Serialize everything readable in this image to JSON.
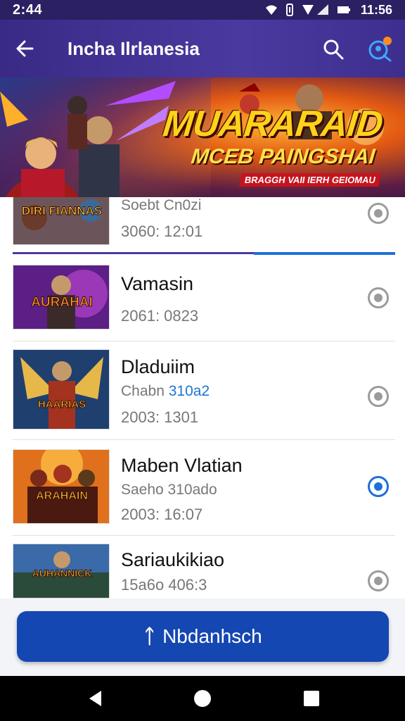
{
  "status_bar": {
    "time": "2:44",
    "clock": "11:56",
    "icons": [
      "wifi-icon",
      "vibrate-icon",
      "signal-icon",
      "battery-icon"
    ]
  },
  "app_bar": {
    "title": "Incha Ilrlanesia",
    "back_icon": "arrow-left-icon",
    "search_icon": "search-icon",
    "profile_icon": "profile-search-icon",
    "notification_color": "#ff8a1e"
  },
  "banner": {
    "title": "MUARARAID",
    "subtitle": "MCEB PAINGSHAI",
    "tagline": "BRAGGH VAII IERH GEIOMAU"
  },
  "list": {
    "progress_fraction": 0.37,
    "items": [
      {
        "thumb_text": "DIRI FIANNAS",
        "title": "",
        "subtitle": "Soebt Cn0zi",
        "subtitle_accent": "",
        "date": "3060: 12:01",
        "selected": false
      },
      {
        "thumb_text": "AURAHAI",
        "title": "Vamasin",
        "subtitle": "",
        "subtitle_accent": "",
        "date": "2061: 0823",
        "selected": false
      },
      {
        "thumb_text": "HAARIAS",
        "title": "Dladuiim",
        "subtitle": "Chabn",
        "subtitle_accent": "310a2",
        "date": "2003: 1301",
        "selected": false
      },
      {
        "thumb_text": "ARAHAIN",
        "title": "Maben Vlatian",
        "subtitle": "Saeho 310ado",
        "subtitle_accent": "",
        "date": "2003: 16:07",
        "selected": true
      },
      {
        "thumb_text": "AUHANNICK",
        "title": "Sariaukikiao",
        "subtitle": "",
        "subtitle_accent": "",
        "date": "15a6o 406:3",
        "selected": false
      }
    ]
  },
  "primary_button": {
    "icon_glyph": "ᛏ",
    "label": "Nbdanhsch"
  },
  "nav_bar": {
    "back_icon": "nav-back-icon",
    "home_icon": "nav-home-icon",
    "recent_icon": "nav-recent-icon"
  },
  "colors": {
    "app_bar": "#3a2a86",
    "accent": "#1e6fd9",
    "button": "#1547b2"
  }
}
